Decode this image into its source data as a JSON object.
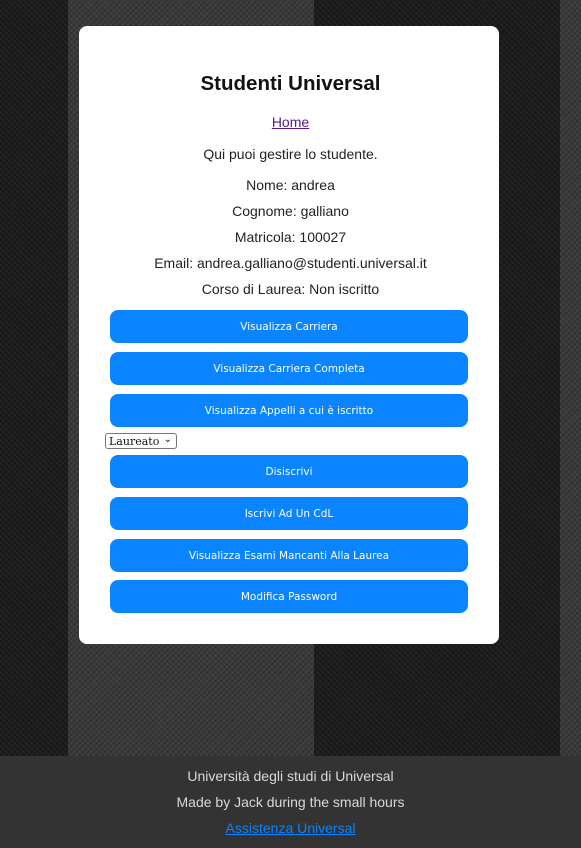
{
  "page": {
    "title": "Studenti Universal",
    "home_link": "Home",
    "intro": "Qui puoi gestire lo studente."
  },
  "student": {
    "nome": "Nome: andrea",
    "cognome": "Cognome: galliano",
    "matricola": "Matricola: 100027",
    "email": "Email: andrea.galliano@studenti.universal.it",
    "corso": "Corso di Laurea: Non iscritto"
  },
  "buttons": {
    "visualizza_carriera": "Visualizza Carriera",
    "visualizza_carriera_completa": "Visualizza Carriera Completa",
    "visualizza_appelli": "Visualizza Appelli a cui è iscritto",
    "disiscrivi": "Disiscrivi",
    "iscrivi_cdl": "Iscrivi Ad Un CdL",
    "esami_mancanti": "Visualizza Esami Mancanti Alla Laurea",
    "modifica_password": "Modifica Password"
  },
  "status_select": {
    "selected": "Laureato"
  },
  "footer": {
    "line1": "Università degli studi di Universal",
    "line2": "Made by Jack during the small hours",
    "support_link": "Assistenza Universal"
  },
  "colors": {
    "button": "#0a84ff",
    "link_visited": "#551a8b",
    "footer_bg": "#333333"
  }
}
